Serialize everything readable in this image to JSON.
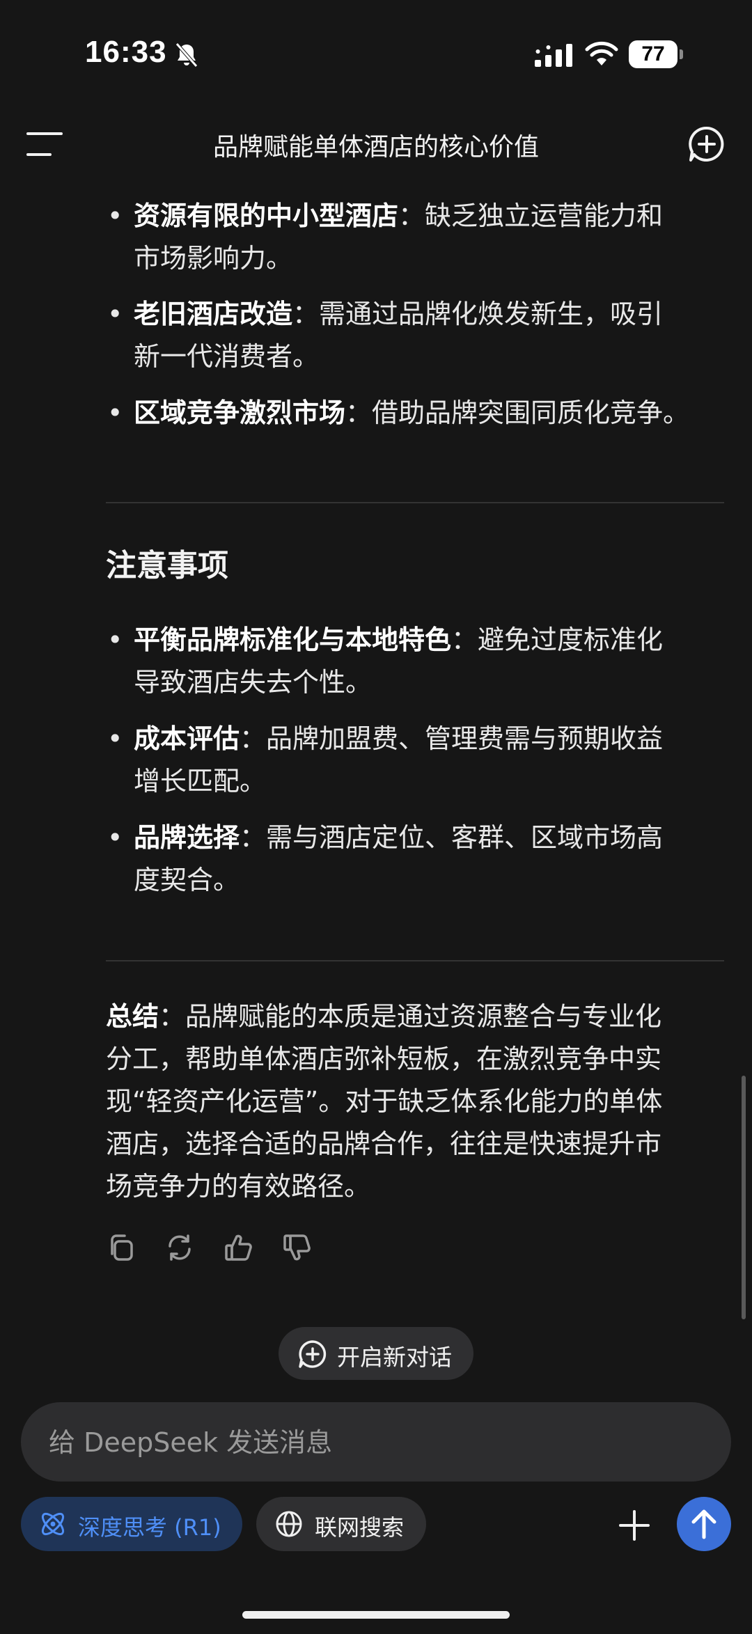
{
  "status_bar": {
    "time": "16:33",
    "battery": "77"
  },
  "header": {
    "title": "品牌赋能单体酒店的核心价值"
  },
  "top_bullets": [
    {
      "bold": "资源有限的中小型酒店",
      "sep": "：",
      "text": "缺乏独立运营能力和",
      "text2": "市场影响力。"
    },
    {
      "bold": "老旧酒店改造",
      "sep": "：",
      "text": "需通过品牌化焕发新生，吸引",
      "text2": "新一代消费者。"
    },
    {
      "bold": "区域竞争激烈市场",
      "sep": "：",
      "text": "借助品牌突围同质化竞争。",
      "text2": ""
    }
  ],
  "notes": {
    "heading": "注意事项",
    "items": [
      {
        "bold": "平衡品牌标准化与本地特色",
        "sep": "：",
        "text": "避免过度标准化",
        "text2": "导致酒店失去个性。"
      },
      {
        "bold": "成本评估",
        "sep": "：",
        "text": "品牌加盟费、管理费需与预期收益",
        "text2": "增长匹配。"
      },
      {
        "bold": "品牌选择",
        "sep": "：",
        "text": "需与酒店定位、客群、区域市场高",
        "text2": "度契合。"
      }
    ]
  },
  "summary": {
    "bold": "总结",
    "sep": "：",
    "l1": "品牌赋能的本质是通过资源整合与专业化",
    "l2": "分工，帮助单体酒店弥补短板，在激烈竞争中实",
    "l3": "现“轻资产化运营”。对于缺乏体系化能力的单体",
    "l4": "酒店，选择合适的品牌合作，往往是快速提升市",
    "l5": "场竞争力的有效路径。"
  },
  "new_chat": {
    "label": "开启新对话"
  },
  "composer": {
    "placeholder": "给 DeepSeek 发送消息"
  },
  "buttons": {
    "deep_think": "深度思考 (R1)",
    "web_search": "联网搜索"
  },
  "colors": {
    "accent": "#3b6fd8",
    "deep_think_text": "#4f8ff7",
    "background": "#161616"
  }
}
